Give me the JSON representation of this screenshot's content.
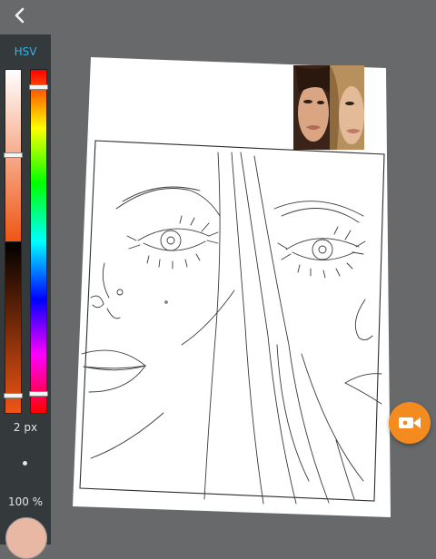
{
  "toolbar": {
    "back_icon": "chevron-left-icon"
  },
  "color_panel": {
    "mode_label": "HSV",
    "saturation": 0.3,
    "value": 0.95,
    "hue": 0.05,
    "brush_size_label": "2 px",
    "opacity_label": "100 %",
    "current_color": "#e8b8a4"
  },
  "canvas": {
    "background": "#ffffff",
    "line_color": "#3a3a3a"
  },
  "record_button": {
    "icon": "video-camera-icon",
    "color": "#f48b1f"
  },
  "colors": {
    "accent": "#37b3e8",
    "panel": "#34393b",
    "workspace": "#67696b"
  }
}
